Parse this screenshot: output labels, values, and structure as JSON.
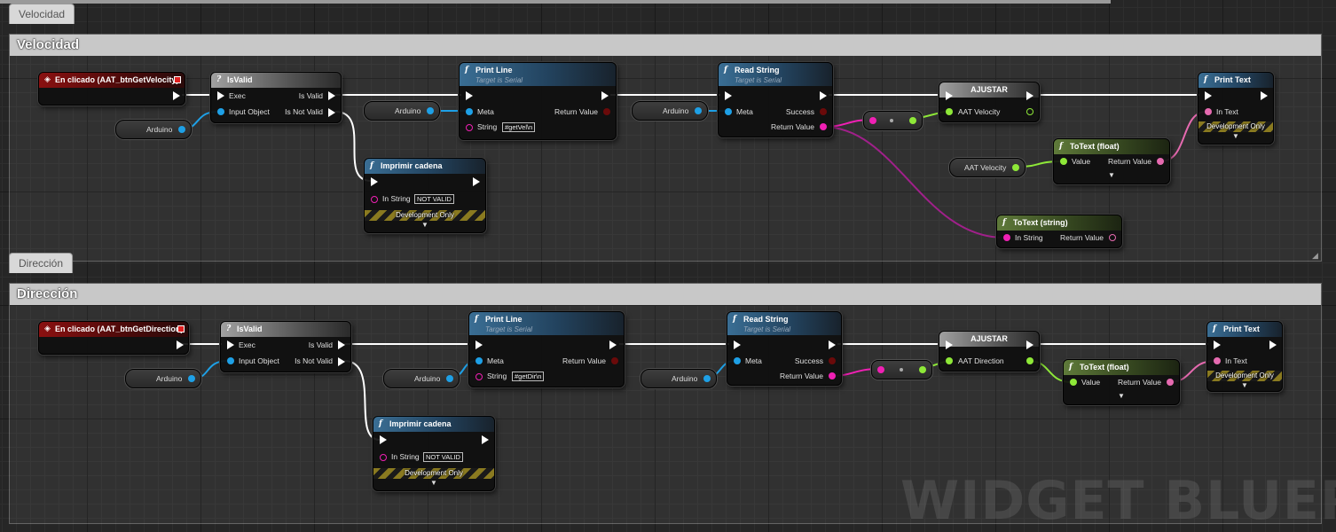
{
  "sections": [
    {
      "tab": "Velocidad",
      "title": "Velocidad",
      "event": "En clicado (AAT_btnGetVelocity)",
      "isvalid": {
        "title": "IsValid",
        "exec": "Exec",
        "input": "Input Object",
        "is_valid": "Is Valid",
        "not_valid": "Is Not Valid"
      },
      "var_arduino": "Arduino",
      "print_line": {
        "title": "Print Line",
        "subtitle": "Target is Serial",
        "meta": "Meta",
        "ret": "Return Value",
        "string_label": "String",
        "string_value": "#getVel\\n"
      },
      "var_arduino2": "Arduino",
      "read_string": {
        "title": "Read String",
        "subtitle": "Target is Serial",
        "meta": "Meta",
        "success": "Success",
        "ret": "Return Value"
      },
      "ajustar": {
        "title": "AJUSTAR",
        "pin": "AAT Velocity"
      },
      "print_text": {
        "title": "Print Text",
        "in": "In Text",
        "dev": "Development Only"
      },
      "imprimir": {
        "title": "Imprimir cadena",
        "in": "In String",
        "value": "NOT VALID",
        "dev": "Development Only"
      },
      "totext_float": {
        "title": "ToText (float)",
        "value": "Value",
        "ret": "Return Value"
      },
      "var_aat": "AAT Velocity",
      "totext_string": {
        "title": "ToText (string)",
        "in": "In String",
        "ret": "Return Value"
      }
    },
    {
      "tab": "Dirección",
      "title": "Dirección",
      "event": "En clicado (AAT_btnGetDirection)",
      "isvalid": {
        "title": "IsValid",
        "exec": "Exec",
        "input": "Input Object",
        "is_valid": "Is Valid",
        "not_valid": "Is Not Valid"
      },
      "var_arduino": "Arduino",
      "print_line": {
        "title": "Print Line",
        "subtitle": "Target is Serial",
        "meta": "Meta",
        "ret": "Return Value",
        "string_label": "String",
        "string_value": "#getDir\\n"
      },
      "var_arduino2": "Arduino",
      "read_string": {
        "title": "Read String",
        "subtitle": "Target is Serial",
        "meta": "Meta",
        "success": "Success",
        "ret": "Return Value"
      },
      "ajustar": {
        "title": "AJUSTAR",
        "pin": "AAT Direction"
      },
      "print_text": {
        "title": "Print Text",
        "in": "In Text",
        "dev": "Development Only"
      },
      "imprimir": {
        "title": "Imprimir cadena",
        "in": "In String",
        "value": "NOT VALID",
        "dev": "Development Only"
      },
      "totext_float": {
        "title": "ToText (float)",
        "value": "Value",
        "ret": "Return Value"
      }
    }
  ],
  "watermark": "WIDGET BLUEPRINT",
  "colors": {
    "object_pin": "#1ea0e6",
    "string_pin": "#f020b4",
    "float_pin": "#8ee838",
    "exec_pin": "#ffffff",
    "text_pin": "#e66ab0",
    "comment_bar": "#c8c8c8"
  },
  "icons": {
    "function": "function-f-icon",
    "event": "event-diamond-icon",
    "macro": "question-mark-icon",
    "set": "set-variable-icon"
  }
}
